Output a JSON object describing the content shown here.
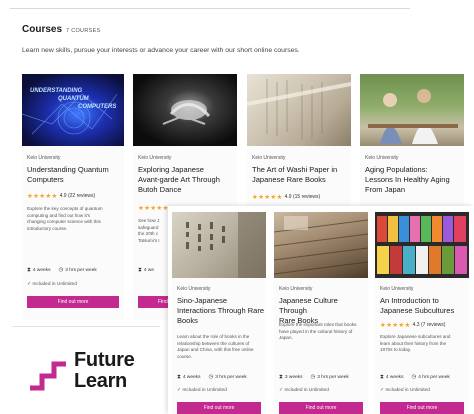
{
  "header": {
    "title": "Courses",
    "count": "7 COURSES",
    "intro": "Learn new skills, pursue your interests or advance your career with our short online courses."
  },
  "cards": [
    {
      "image": "Quantum computing graphic with the text Understanding Quantum Computers",
      "provider": "Keio University",
      "title_lines": [
        "Understanding Quantum",
        "Computers"
      ],
      "rating": "4.9 (22 reviews)",
      "desc_lines": [
        "Explore the key concepts of quantum",
        "computing and find out how it's",
        "changing computer science with this",
        "introductory course."
      ],
      "duration": "4 weeks",
      "effort": "3 hrs per week",
      "included": "Included in Unlimited",
      "button": "Find out more"
    },
    {
      "image": "Black and white photo of a Butoh dancer",
      "provider": "Keio University",
      "title_lines": [
        "Exploring Japanese",
        "Avant-garde Art Through",
        "Butoh Dance"
      ],
      "desc_lines": [
        "See how J",
        "safeguard",
        "the 20th c",
        "Tatsumi's I"
      ],
      "duration": "4 we",
      "button": "Find"
    },
    {
      "image": "Washi paper book pages",
      "provider": "Keio University",
      "title_lines": [
        "The Art of Washi Paper in",
        "Japanese Rare Books"
      ],
      "rating": "4.9 (15 reviews)"
    },
    {
      "image": "Elderly people sitting on a bench",
      "provider": "Keio University",
      "title_lines": [
        "Aging Populations:",
        "Lessons In Healthy Aging",
        "From Japan"
      ]
    },
    {
      "image": "Old Chinese book with ink characters",
      "provider": "Keio University",
      "title_lines": [
        "Sino-Japanese",
        "Interactions Through Rare",
        "Books"
      ],
      "desc_lines": [
        "Learn about the role of books in the",
        "relationship between the cultures of",
        "Japan and China, with this free online",
        "course."
      ],
      "duration": "4 weeks",
      "effort": "3 hrs per week",
      "included": "Included in Unlimited",
      "button": "Find out more"
    },
    {
      "image": "Stack of old Japanese rare books",
      "provider": "Keio University",
      "title_lines": [
        "Japanese Culture Through",
        "Rare Books"
      ],
      "desc_lines": [
        "Explore the important roles that books",
        "have played in the cultural history of",
        "Japan."
      ],
      "duration": "3 weeks",
      "effort": "3 hrs per week",
      "included": "Included in Unlimited",
      "button": "Find out more"
    },
    {
      "image": "Shelves of colourful Japanese magazines",
      "provider": "Keio University",
      "title_lines": [
        "An Introduction to",
        "Japanese Subcultures"
      ],
      "rating": "4.3 (7 reviews)",
      "desc_lines": [
        "Explore Japanese subcultures and",
        "learn about their history from the",
        "1970s to today."
      ],
      "duration": "4 weeks",
      "effort": "4 hrs per week",
      "included": "Included in Unlimited",
      "button": "Find out more"
    }
  ],
  "overlay": {
    "quantum_image_text": [
      "UNDERSTANDING",
      "QUANTUM",
      "COMPUTERS"
    ]
  },
  "stars": "★★★★★",
  "icons": {
    "duration": "hourglass-icon",
    "effort": "clock-icon"
  },
  "brand": {
    "name_line1": "Future",
    "name_line2": "Learn",
    "accent": "#c22a90",
    "logo_color": "#c22a90"
  }
}
